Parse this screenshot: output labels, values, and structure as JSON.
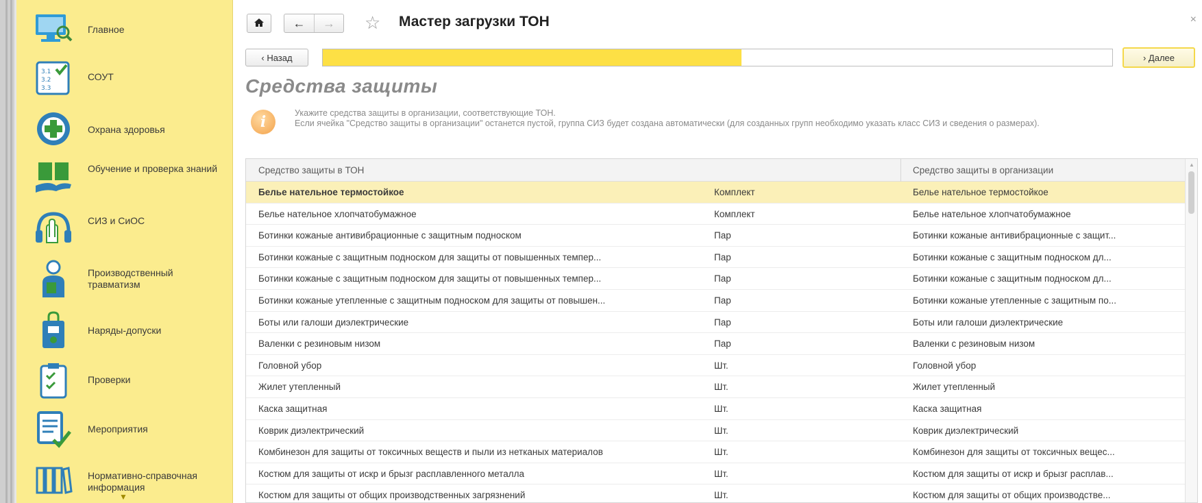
{
  "sidebar": {
    "items": [
      {
        "label": "Главное",
        "icon": "monitor-search-icon"
      },
      {
        "label": "СОУТ",
        "icon": "checklist-numbers-icon"
      },
      {
        "label": "Охрана здоровья",
        "icon": "medical-cross-icon"
      },
      {
        "label": "Обучение и проверка знаний",
        "icon": "book-hand-icon"
      },
      {
        "label": "СИЗ и СиОС",
        "icon": "glove-headphones-icon"
      },
      {
        "label": "Производственный травматизм",
        "icon": "injured-person-icon"
      },
      {
        "label": "Наряды-допуски",
        "icon": "lock-badge-icon"
      },
      {
        "label": "Проверки",
        "icon": "clipboard-check-icon"
      },
      {
        "label": "Мероприятия",
        "icon": "document-check-icon"
      },
      {
        "label": "Нормативно-справочная информация",
        "icon": "books-icon"
      }
    ],
    "more_icon": "chevron-down-icon"
  },
  "header": {
    "title": "Мастер загрузки ТОН",
    "home_icon": "home-icon",
    "back_icon": "arrow-left-icon",
    "forward_icon": "arrow-right-icon",
    "favorite_icon": "star-icon",
    "close_icon": "close-icon"
  },
  "wizard": {
    "back_label": "‹  Назад",
    "next_label": "›  Далее",
    "progress_fraction": 0.53,
    "progress_color": "#fde045"
  },
  "section": {
    "title": "Средства защиты",
    "info_line1": "Укажите средства защиты в организации, соответствующие ТОН.",
    "info_line2": "Если ячейка \"Средство защиты в организации\" останется пустой, группа СИЗ будет создана автоматически (для созданных групп необходимо указать класс СИЗ и сведения о размерах)."
  },
  "table": {
    "headers": [
      "Средство защиты в ТОН",
      "",
      "Средство защиты в организации"
    ],
    "rows": [
      [
        "Белье нательное термостойкое",
        "Комплект",
        "Белье нательное термостойкое"
      ],
      [
        "Белье нательное хлопчатобумажное",
        "Комплект",
        "Белье нательное хлопчатобумажное"
      ],
      [
        "Ботинки кожаные антивибрационные с защитным подноском",
        "Пар",
        "Ботинки кожаные антивибрационные с защит..."
      ],
      [
        "Ботинки кожаные с защитным подноском для защиты от повышенных темпер...",
        "Пар",
        "Ботинки кожаные с защитным подноском дл..."
      ],
      [
        "Ботинки кожаные с защитным подноском для защиты от повышенных темпер...",
        "Пар",
        "Ботинки кожаные с защитным подноском дл..."
      ],
      [
        "Ботинки кожаные утепленные с защитным подноском для защиты от повышен...",
        "Пар",
        "Ботинки кожаные утепленные с защитным по..."
      ],
      [
        "Боты или галоши диэлектрические",
        "Пар",
        "Боты или галоши диэлектрические"
      ],
      [
        "Валенки с резиновым низом",
        "Пар",
        "Валенки с резиновым низом"
      ],
      [
        "Головной убор",
        "Шт.",
        "Головной убор"
      ],
      [
        "Жилет утепленный",
        "Шт.",
        "Жилет утепленный"
      ],
      [
        "Каска защитная",
        "Шт.",
        "Каска защитная"
      ],
      [
        "Коврик диэлектрический",
        "Шт.",
        "Коврик диэлектрический"
      ],
      [
        "Комбинезон для защиты от токсичных веществ и пыли из нетканых материалов",
        "Шт.",
        "Комбинезон для защиты от токсичных вещес..."
      ],
      [
        "Костюм для защиты от искр и брызг расплавленного металла",
        "Шт.",
        "Костюм для защиты от искр и брызг расплав..."
      ],
      [
        "Костюм для защиты от общих производственных загрязнений",
        "Шт.",
        "Костюм для защиты от общих производстве..."
      ]
    ],
    "selected_row": 0
  }
}
